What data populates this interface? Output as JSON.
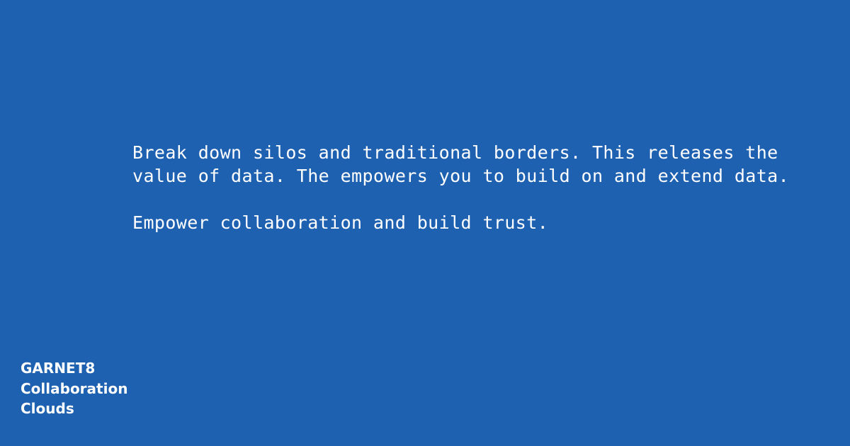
{
  "message": {
    "paragraph_1": "Break down silos and traditional borders. This releases the value of data. The empowers you to build on and extend data.",
    "paragraph_2": "Empower collaboration and build trust."
  },
  "brand": {
    "line_1": "GARNET8",
    "line_2": "Collaboration",
    "line_3": "Clouds"
  },
  "colors": {
    "background": "#1f61b1",
    "text": "#ffffff"
  }
}
